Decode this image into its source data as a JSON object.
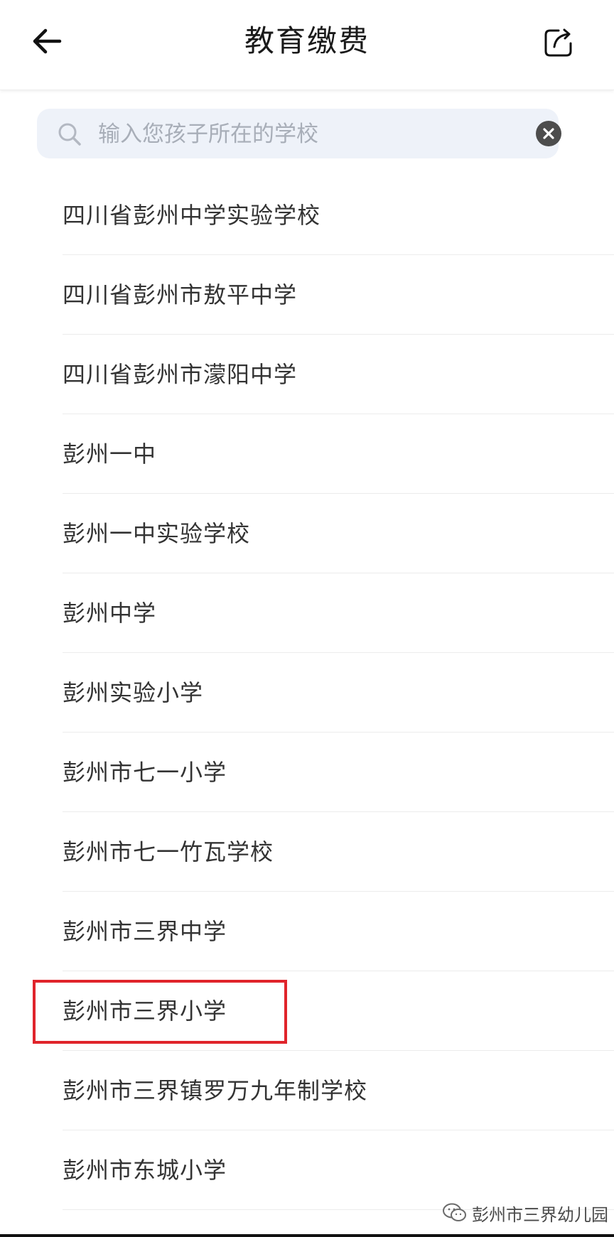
{
  "header": {
    "title": "教育缴费",
    "back_icon": "arrow-left-icon",
    "share_icon": "share-icon"
  },
  "search": {
    "placeholder": "输入您孩子所在的学校",
    "value": ""
  },
  "schools": [
    "四川省彭州中学实验学校",
    "四川省彭州市敖平中学",
    "四川省彭州市濛阳中学",
    "彭州一中",
    "彭州一中实验学校",
    "彭州中学",
    "彭州实验小学",
    "彭州市七一小学",
    "彭州市七一竹瓦学校",
    "彭州市三界中学",
    "彭州市三界小学",
    "彭州市三界镇罗万九年制学校",
    "彭州市东城小学"
  ],
  "highlighted_school": "彭州市三界小学",
  "highlight_color": "#e0242b",
  "watermark": {
    "text": "彭州市三界幼儿园",
    "icon": "wechat-icon"
  }
}
